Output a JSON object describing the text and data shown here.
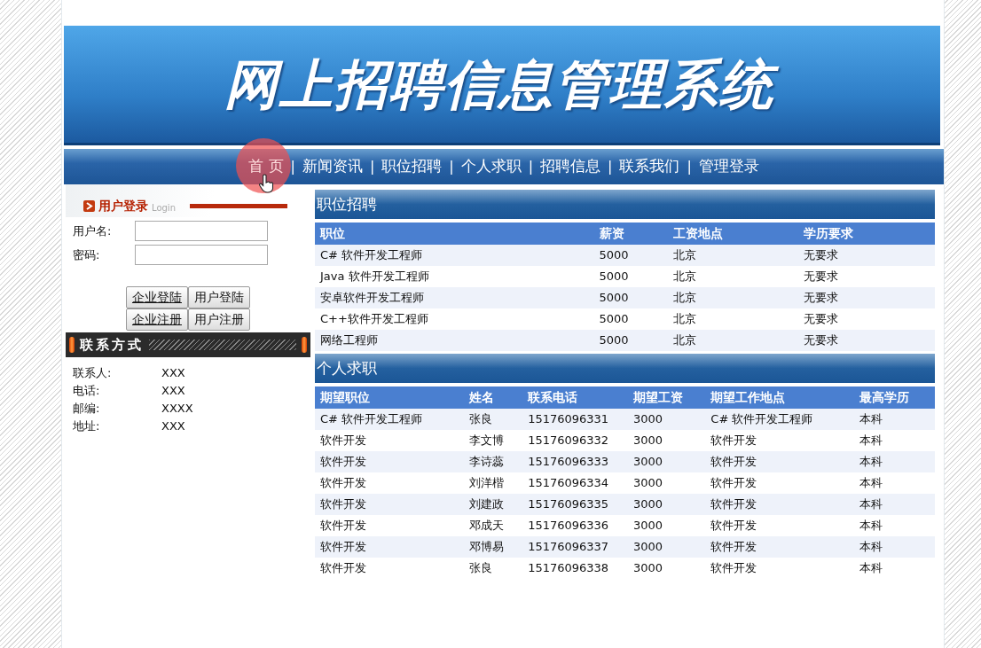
{
  "banner": {
    "title": "网上招聘信息管理系统"
  },
  "nav": {
    "items": [
      {
        "label": "首 页",
        "selected": true
      },
      {
        "label": "新闻资讯",
        "selected": false
      },
      {
        "label": "职位招聘",
        "selected": false
      },
      {
        "label": "个人求职",
        "selected": false
      },
      {
        "label": "招聘信息",
        "selected": false
      },
      {
        "label": "联系我们",
        "selected": false
      },
      {
        "label": "管理登录",
        "selected": false
      }
    ],
    "separators": [
      "|",
      "|",
      "|",
      "|",
      "|",
      "|"
    ]
  },
  "login": {
    "title": "用户登录",
    "subtitle": "Login",
    "fields": [
      {
        "label": "用户名:"
      },
      {
        "label": "密码:"
      }
    ],
    "buttons": [
      "企业登陆",
      "用户登陆",
      "企业注册",
      "用户注册"
    ]
  },
  "contact": {
    "title": "联系方式",
    "rows": [
      {
        "label": "联系人:",
        "value": "XXX"
      },
      {
        "label": "电话:",
        "value": "XXX"
      },
      {
        "label": "邮编:",
        "value": "XXXX"
      },
      {
        "label": "地址:",
        "value": "XXX"
      }
    ]
  },
  "jobs": {
    "title": "职位招聘",
    "columns": [
      "职位",
      "薪资",
      "工资地点",
      "学历要求"
    ],
    "rows": [
      [
        "C# 软件开发工程师",
        "5000",
        "北京",
        "无要求"
      ],
      [
        "Java 软件开发工程师",
        "5000",
        "北京",
        "无要求"
      ],
      [
        "安卓软件开发工程师",
        "5000",
        "北京",
        "无要求"
      ],
      [
        "C++软件开发工程师",
        "5000",
        "北京",
        "无要求"
      ],
      [
        "网络工程师",
        "5000",
        "北京",
        "无要求"
      ]
    ]
  },
  "seekers": {
    "title": "个人求职",
    "columns": [
      "期望职位",
      "姓名",
      "联系电话",
      "期望工资",
      "期望工作地点",
      "最高学历"
    ],
    "rows": [
      [
        "C# 软件开发工程师",
        "张良",
        "15176096331",
        "3000",
        "C# 软件开发工程师",
        "本科"
      ],
      [
        "软件开发",
        "李文博",
        "15176096332",
        "3000",
        "软件开发",
        "本科"
      ],
      [
        "软件开发",
        "李诗蕊",
        "15176096333",
        "3000",
        "软件开发",
        "本科"
      ],
      [
        "软件开发",
        "刘洋楷",
        "15176096334",
        "3000",
        "软件开发",
        "本科"
      ],
      [
        "软件开发",
        "刘建政",
        "15176096335",
        "3000",
        "软件开发",
        "本科"
      ],
      [
        "软件开发",
        "邓成天",
        "15176096336",
        "3000",
        "软件开发",
        "本科"
      ],
      [
        "软件开发",
        "邓博易",
        "15176096337",
        "3000",
        "软件开发",
        "本科"
      ],
      [
        "软件开发",
        "张良",
        "15176096338",
        "3000",
        "软件开发",
        "本科"
      ]
    ]
  }
}
